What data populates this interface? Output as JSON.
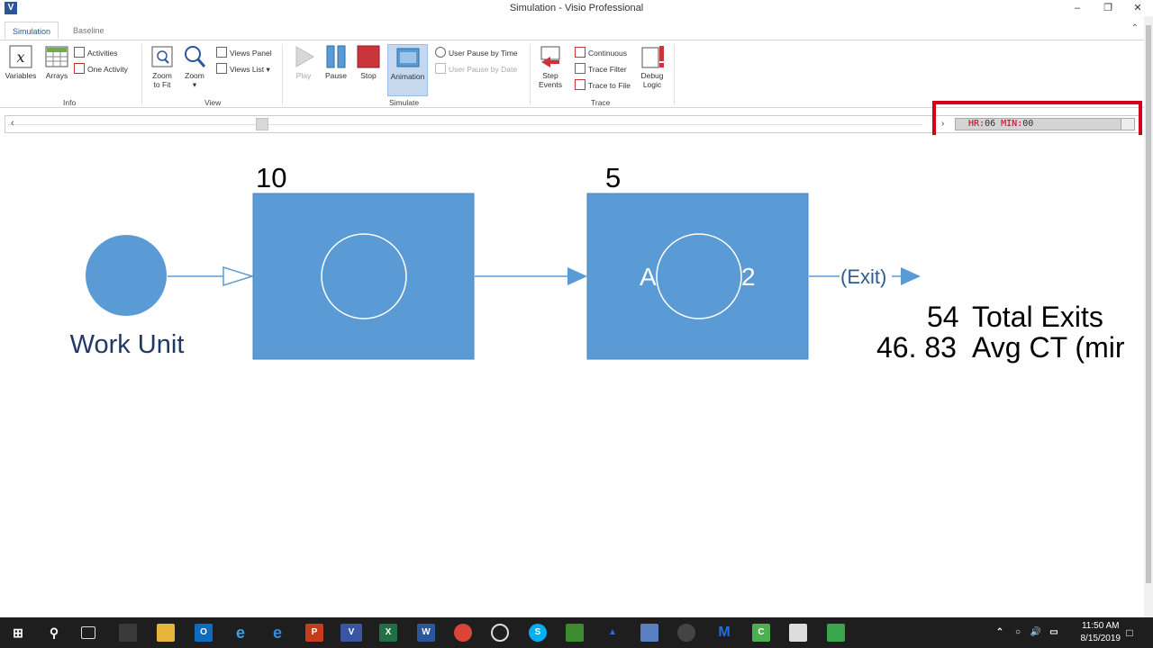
{
  "window": {
    "title": "Simulation - Visio Professional",
    "app_icon": "V"
  },
  "tabs": [
    {
      "label": "Simulation"
    },
    {
      "label": "Baseline"
    }
  ],
  "ribbon": {
    "info": {
      "label": "Info",
      "variables": "Variables",
      "arrays": "Arrays",
      "activities": "Activities",
      "one_activity": "One Activity"
    },
    "view": {
      "label": "View",
      "zoom_to_fit_1": "Zoom",
      "zoom_to_fit_2": "to Fit",
      "zoom": "Zoom",
      "views_panel": "Views Panel",
      "views_list": "Views List"
    },
    "simulate": {
      "label": "Simulate",
      "play": "Play",
      "pause": "Pause",
      "stop": "Stop",
      "animation": "Animation",
      "user_pause_time": "User Pause by Time",
      "user_pause_date": "User Pause by Date"
    },
    "trace": {
      "label": "Trace",
      "step_events_1": "Step",
      "step_events_2": "Events",
      "continuous": "Continuous",
      "trace_filter": "Trace Filter",
      "trace_to_file": "Trace to File",
      "debug_logic_1": "Debug",
      "debug_logic_2": "Logic"
    }
  },
  "clock": {
    "hr_label": "HR:",
    "hr_value": "06",
    "min_label": "MIN:",
    "min_value": "00"
  },
  "diagram": {
    "source_label": "Work Unit",
    "box1_count": "10",
    "box2_count": "5",
    "box2_left": "A",
    "box2_right": "2",
    "exit_label": "(Exit)",
    "stat1_value": "54",
    "stat1_label": "Total Exits",
    "stat2_value": "46. 83",
    "stat2_label": "Avg CT (mir"
  },
  "colors": {
    "shape": "#5b9bd5",
    "accent": "#2b579a",
    "highlight": "#d0021b"
  },
  "taskbar": {
    "time": "11:50 AM",
    "date": "8/15/2019"
  }
}
